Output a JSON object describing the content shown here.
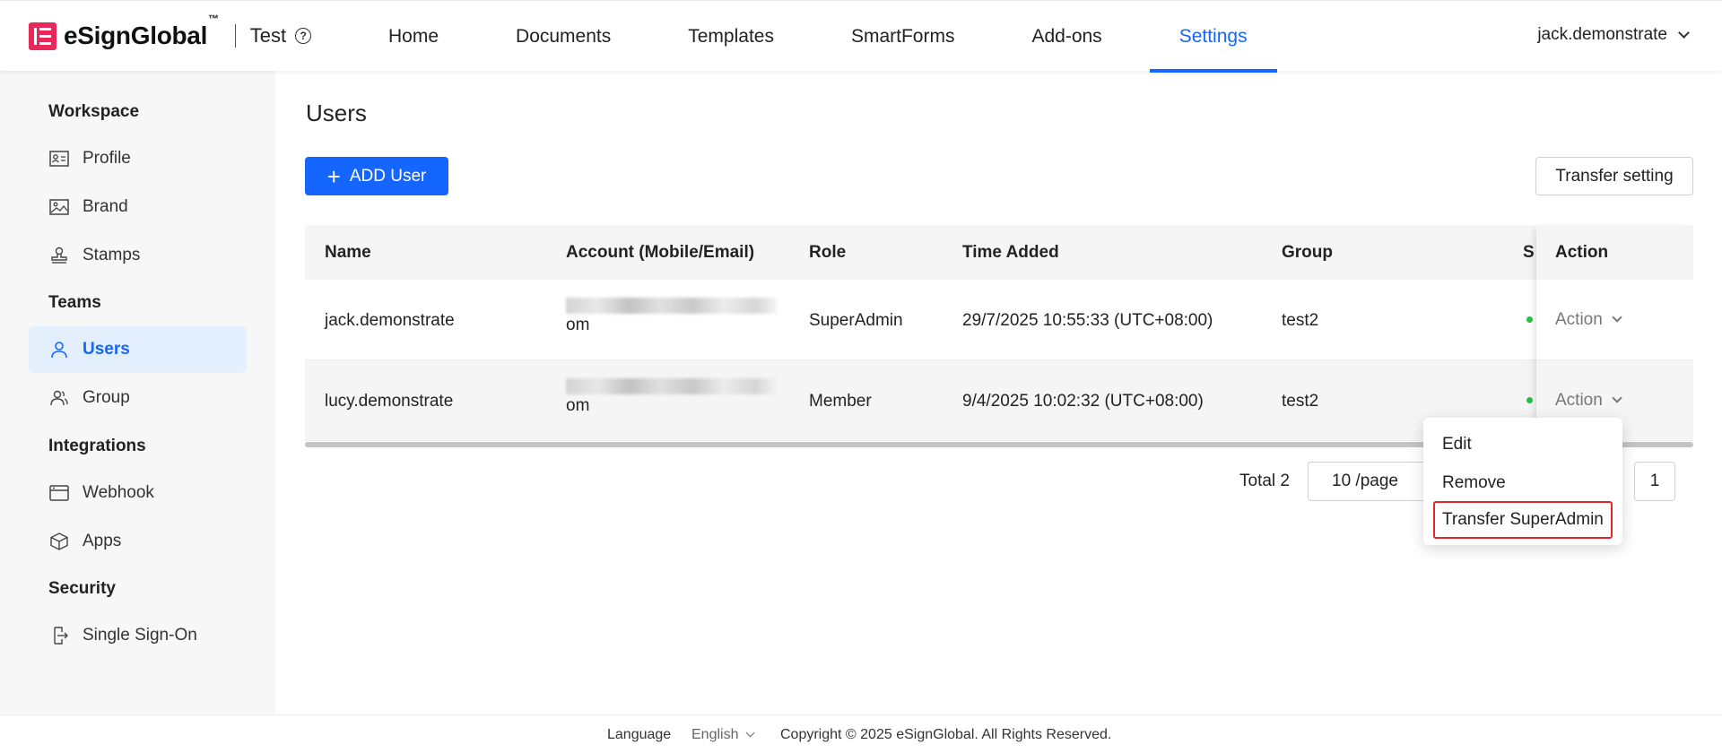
{
  "header": {
    "brand": "eSignGlobal",
    "brand_tm": "™",
    "workspace": "Test",
    "help_glyph": "?",
    "nav": [
      {
        "label": "Home",
        "active": false
      },
      {
        "label": "Documents",
        "active": false
      },
      {
        "label": "Templates",
        "active": false
      },
      {
        "label": "SmartForms",
        "active": false
      },
      {
        "label": "Add-ons",
        "active": false
      },
      {
        "label": "Settings",
        "active": true
      }
    ],
    "user": "jack.demonstrate",
    "accent_color": "#1565ff",
    "logo_color": "#e8285a"
  },
  "sidebar": {
    "sections": [
      {
        "title": "Workspace",
        "items": [
          {
            "label": "Profile",
            "icon": "id-card-icon"
          },
          {
            "label": "Brand",
            "icon": "image-icon"
          },
          {
            "label": "Stamps",
            "icon": "stamp-icon"
          }
        ]
      },
      {
        "title": "Teams",
        "items": [
          {
            "label": "Users",
            "icon": "user-icon",
            "active": true
          },
          {
            "label": "Group",
            "icon": "group-icon"
          }
        ]
      },
      {
        "title": "Integrations",
        "items": [
          {
            "label": "Webhook",
            "icon": "webhook-icon"
          },
          {
            "label": "Apps",
            "icon": "cube-icon"
          }
        ]
      },
      {
        "title": "Security",
        "items": [
          {
            "label": "Single Sign-On",
            "icon": "sso-icon"
          }
        ]
      }
    ]
  },
  "main": {
    "title": "Users",
    "add_button": "ADD User",
    "add_icon": "+",
    "transfer_button": "Transfer setting",
    "table": {
      "columns": [
        "Name",
        "Account (Mobile/Email)",
        "Role",
        "Time Added",
        "Group",
        "S",
        "Action"
      ],
      "rows": [
        {
          "name": "jack.demonstrate",
          "account_suffix": "om",
          "role": "SuperAdmin",
          "time_added": "29/7/2025 10:55:33 (UTC+08:00)",
          "group": "test2",
          "action": "Action"
        },
        {
          "name": "lucy.demonstrate",
          "account_suffix": "om",
          "role": "Member",
          "time_added": "9/4/2025 10:02:32 (UTC+08:00)",
          "group": "test2",
          "action": "Action"
        }
      ]
    },
    "pagination": {
      "total": "Total 2",
      "page_size": "10 /page",
      "current_page": "1"
    },
    "dropdown": {
      "items": [
        "Edit",
        "Remove",
        "Transfer SuperAdmin"
      ],
      "highlight_color": "#e6252a"
    }
  },
  "footer": {
    "language_label": "Language",
    "language_value": "English",
    "copyright": "Copyright © 2025 eSignGlobal. All Rights Reserved."
  }
}
